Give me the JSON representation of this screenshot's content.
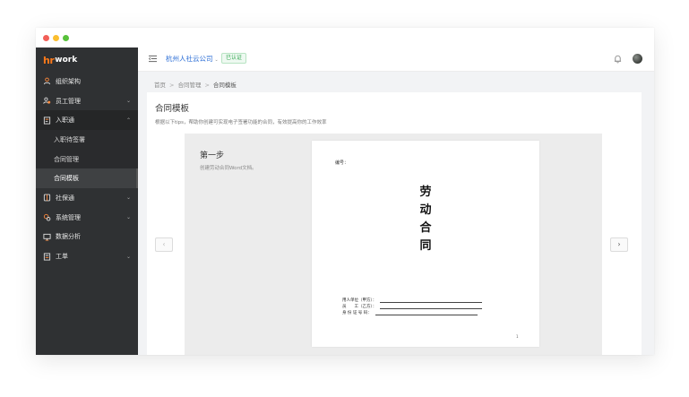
{
  "window": {
    "accent": "#2d6fd6",
    "sidebar_bg": "#2f3133"
  },
  "logo": {
    "mark": "hr",
    "text": "work"
  },
  "sidebar": {
    "items": [
      {
        "label": "组织架构",
        "icon": "user-icon",
        "chevron": ""
      },
      {
        "label": "员工管理",
        "icon": "users-icon",
        "chevron": "⌄"
      },
      {
        "label": "入职通",
        "icon": "document-icon",
        "chevron": "⌃"
      },
      {
        "label": "入职待签署",
        "icon": "",
        "chevron": ""
      },
      {
        "label": "合同管理",
        "icon": "",
        "chevron": ""
      },
      {
        "label": "合同模板",
        "icon": "",
        "chevron": ""
      },
      {
        "label": "社保通",
        "icon": "shield-icon",
        "chevron": "⌄"
      },
      {
        "label": "系统管理",
        "icon": "gear-icon",
        "chevron": "⌄"
      },
      {
        "label": "数据分析",
        "icon": "monitor-icon",
        "chevron": ""
      },
      {
        "label": "工单",
        "icon": "ticket-icon",
        "chevron": "⌄"
      }
    ]
  },
  "header": {
    "company": "杭州人社云公司",
    "badge": "已认证",
    "icons": [
      "menu-icon",
      "bell-icon",
      "avatar"
    ]
  },
  "breadcrumb": {
    "home": "首页",
    "sep": ">",
    "parent": "合同管理",
    "current": "合同模板"
  },
  "card": {
    "title": "合同模板",
    "desc": "根据以下tips，帮助你创建可实现电子签署功能的合同，有效提高你的工作效率",
    "prev": "‹",
    "next": "›"
  },
  "step": {
    "title": "第一步",
    "desc": "创建劳动合同Word文档。"
  },
  "doc": {
    "number_label": "编号：",
    "title_chars": [
      "劳",
      "动",
      "合",
      "同"
    ],
    "sign_lines": [
      "用人单位（甲方）：",
      "员　　工（乙方）：",
      "身 份 证 号 码："
    ],
    "page": "1"
  }
}
